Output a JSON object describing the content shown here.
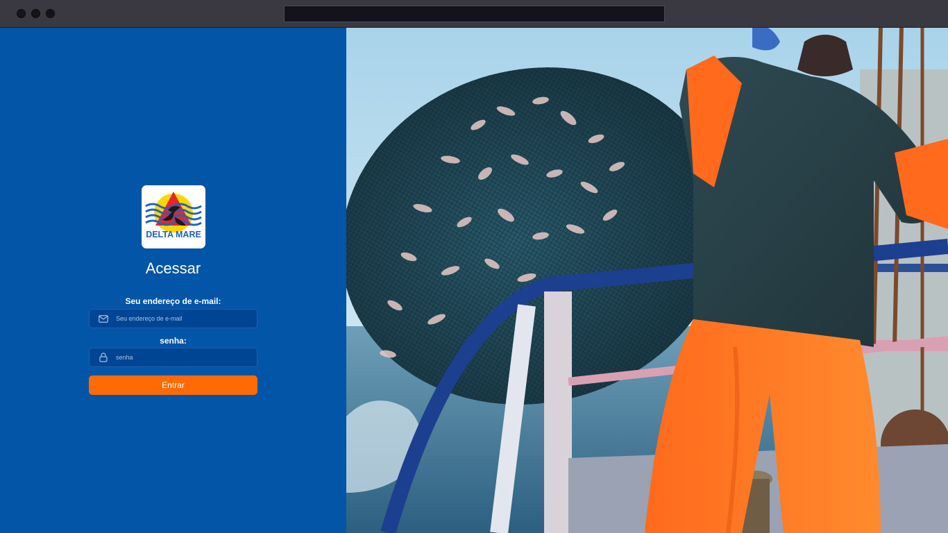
{
  "logo": {
    "text": "DELTA MARE"
  },
  "login": {
    "title": "Acessar",
    "email_label": "Seu endereço de e-mail:",
    "email_placeholder": "Seu endereço de e-mail",
    "password_label": "senha:",
    "password_placeholder": "senha",
    "submit_label": "Entrar"
  },
  "colors": {
    "panel": "#0355a8",
    "field": "#004593",
    "button": "#ff6a05"
  },
  "icons": {
    "email": "envelope-icon",
    "password": "lock-icon"
  }
}
